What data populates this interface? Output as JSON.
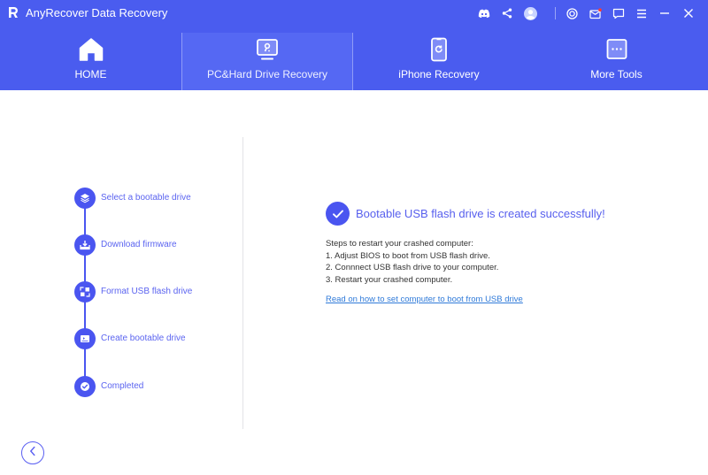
{
  "window": {
    "title": "AnyRecover Data Recovery",
    "titlebar_icons": [
      "discord-icon",
      "share-icon",
      "account-icon",
      "settings-target-icon",
      "mail-icon",
      "feedback-icon",
      "menu-icon",
      "minimize-icon",
      "close-icon"
    ],
    "mail_badge_color": "#ff3b30"
  },
  "colors": {
    "header_bg": "#4a5cef",
    "active_tab_bg": "#5568f3",
    "accent": "#4a55f0",
    "step_text": "#5b64f0",
    "link": "#2f7ad9"
  },
  "nav": {
    "tabs": [
      {
        "label": "HOME",
        "icon": "home-icon",
        "active": false
      },
      {
        "label": "PC&Hard Drive Recovery",
        "icon": "pc-drive-icon",
        "active": true
      },
      {
        "label": "iPhone Recovery",
        "icon": "iphone-refresh-icon",
        "active": false
      },
      {
        "label": "More Tools",
        "icon": "more-tools-icon",
        "active": false
      }
    ]
  },
  "steps": [
    {
      "label": "Select a bootable drive",
      "icon": "layers-icon"
    },
    {
      "label": "Download firmware",
      "icon": "download-tray-icon"
    },
    {
      "label": "Format USB flash drive",
      "icon": "format-grid-icon"
    },
    {
      "label": "Create bootable drive",
      "icon": "create-drive-icon"
    },
    {
      "label": "Completed",
      "icon": "check-circle-icon"
    }
  ],
  "result": {
    "title": "Bootable USB flash drive is created successfully!",
    "instructions_heading": "Steps to restart your crashed computer:",
    "instructions": [
      "1. Adjust BIOS to boot from USB flash drive.",
      "2. Connnect USB flash drive to your computer.",
      "3. Restart your crashed computer."
    ],
    "help_link": "Read on how to set computer to boot from USB drive"
  },
  "footer": {
    "back_icon": "chevron-left-icon"
  }
}
